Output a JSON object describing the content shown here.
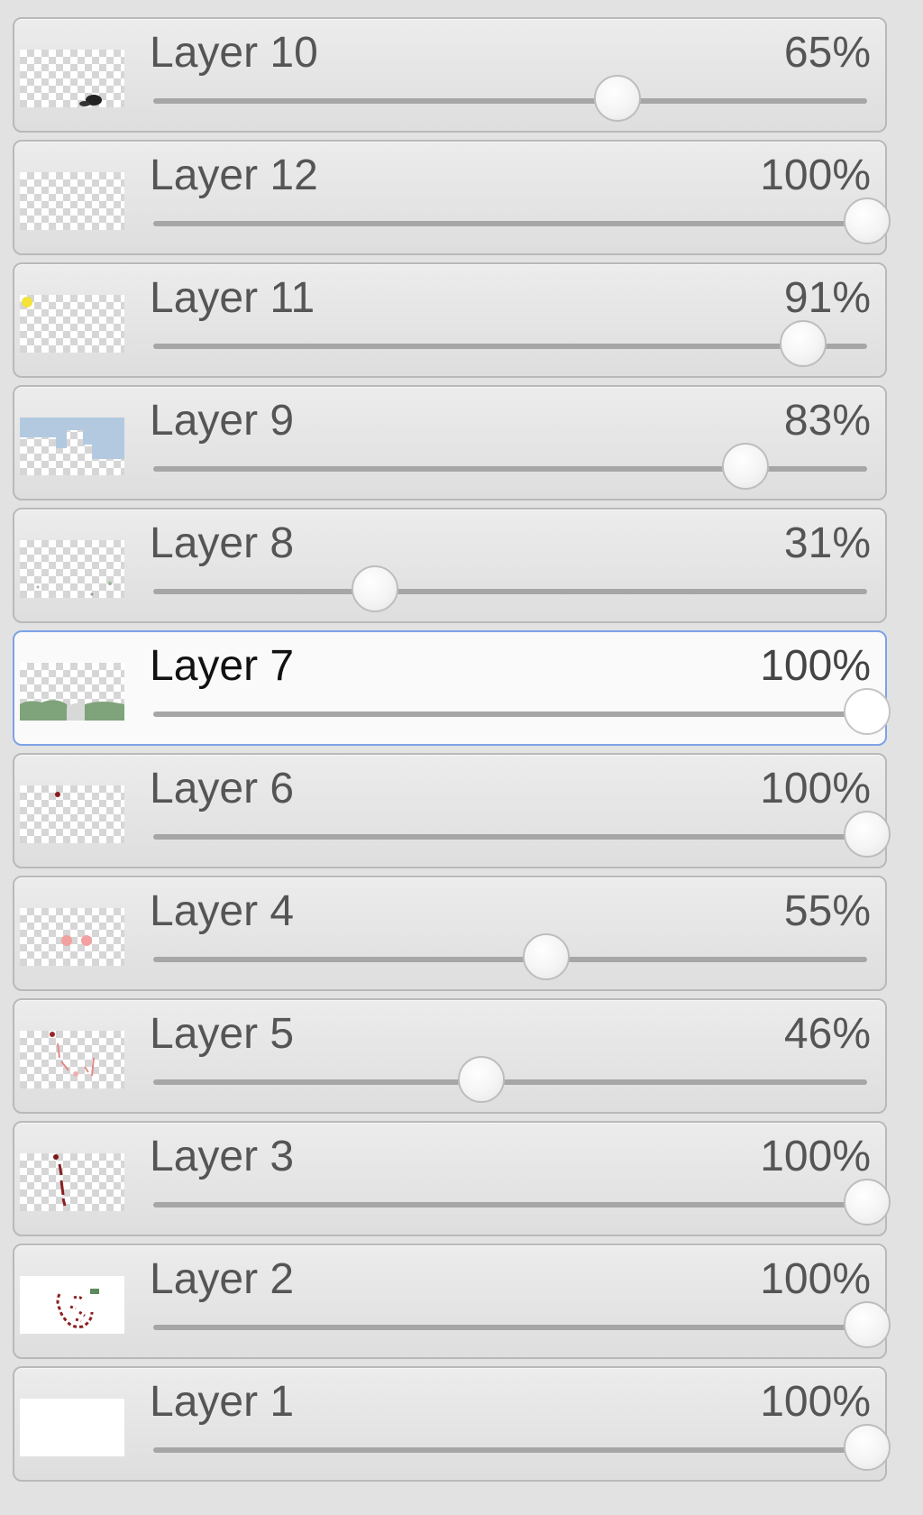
{
  "layers": [
    {
      "name": "Layer 10",
      "opacity_label": "65%",
      "opacity": 0.65,
      "active": false,
      "thumb": "dark-blob"
    },
    {
      "name": "Layer 12",
      "opacity_label": "100%",
      "opacity": 1.0,
      "active": false,
      "thumb": "empty"
    },
    {
      "name": "Layer 11",
      "opacity_label": "91%",
      "opacity": 0.91,
      "active": false,
      "thumb": "yellow-dot"
    },
    {
      "name": "Layer 9",
      "opacity_label": "83%",
      "opacity": 0.83,
      "active": false,
      "thumb": "sky"
    },
    {
      "name": "Layer 8",
      "opacity_label": "31%",
      "opacity": 0.31,
      "active": false,
      "thumb": "faint-marks"
    },
    {
      "name": "Layer 7",
      "opacity_label": "100%",
      "opacity": 1.0,
      "active": true,
      "thumb": "grass"
    },
    {
      "name": "Layer 6",
      "opacity_label": "100%",
      "opacity": 1.0,
      "active": false,
      "thumb": "small-red-dot"
    },
    {
      "name": "Layer 4",
      "opacity_label": "55%",
      "opacity": 0.55,
      "active": false,
      "thumb": "pink-dots"
    },
    {
      "name": "Layer 5",
      "opacity_label": "46%",
      "opacity": 0.46,
      "active": false,
      "thumb": "red-sketch-light"
    },
    {
      "name": "Layer 3",
      "opacity_label": "100%",
      "opacity": 1.0,
      "active": false,
      "thumb": "red-sketch"
    },
    {
      "name": "Layer 2",
      "opacity_label": "100%",
      "opacity": 1.0,
      "active": false,
      "thumb": "face-sketch"
    },
    {
      "name": "Layer 1",
      "opacity_label": "100%",
      "opacity": 1.0,
      "active": false,
      "thumb": "white"
    }
  ],
  "colors": {
    "panel_bg": "#e2e2e2",
    "active_border": "#7ea2e8",
    "track": "#a6a6a6"
  }
}
